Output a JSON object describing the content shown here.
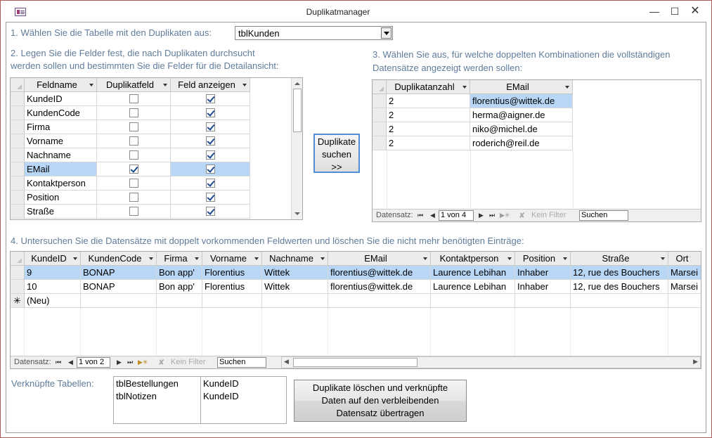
{
  "window": {
    "title": "Duplikatmanager",
    "minimize_icon": "minimize-icon",
    "maximize_icon": "maximize-icon",
    "close_icon": "close-icon"
  },
  "step1": {
    "label": "1. Wählen Sie die Tabelle mit den Duplikaten aus:",
    "combo_value": "tblKunden"
  },
  "step2": {
    "label_line1": "2. Legen Sie die Felder fest, die nach Duplikaten durchsucht",
    "label_line2": "werden sollen und bestimmten Sie die Felder für die Detailansicht:",
    "columns": [
      "Feldname",
      "Duplikatfeld",
      "Feld anzeigen"
    ],
    "rows": [
      {
        "name": "KundeID",
        "dup": false,
        "show": true
      },
      {
        "name": "KundenCode",
        "dup": false,
        "show": true
      },
      {
        "name": "Firma",
        "dup": false,
        "show": true
      },
      {
        "name": "Vorname",
        "dup": false,
        "show": true
      },
      {
        "name": "Nachname",
        "dup": false,
        "show": true
      },
      {
        "name": "EMail",
        "dup": true,
        "show": true,
        "selected": true
      },
      {
        "name": "Kontaktperson",
        "dup": false,
        "show": true
      },
      {
        "name": "Position",
        "dup": false,
        "show": true
      },
      {
        "name": "Straße",
        "dup": false,
        "show": true
      }
    ]
  },
  "search_button": {
    "line1": "Duplikate",
    "line2": "suchen",
    "line3": ">>"
  },
  "step3": {
    "label_line1": "3. Wählen Sie aus, für welche doppelten Kombinationen die vollständigen",
    "label_line2": "Datensätze angezeigt werden sollen:",
    "columns": [
      "Duplikatanzahl",
      "EMail"
    ],
    "rows": [
      [
        "2",
        "florentius@wittek.de"
      ],
      [
        "2",
        "herma@aigner.de"
      ],
      [
        "2",
        "niko@michel.de"
      ],
      [
        "2",
        "roderich@reil.de"
      ]
    ],
    "nav": {
      "label": "Datensatz:",
      "position": "1 von 4",
      "filter": "Kein Filter",
      "search": "Suchen"
    }
  },
  "step4": {
    "label": "4. Untersuchen Sie die Datensätze mit doppelt vorkommenden Feldwerten und löschen Sie die nicht mehr benötigten Einträge:",
    "columns": [
      "KundeID",
      "KundenCode",
      "Firma",
      "Vorname",
      "Nachname",
      "EMail",
      "Kontaktperson",
      "Position",
      "Straße",
      "Ort"
    ],
    "rows": [
      [
        "9",
        "BONAP",
        "Bon app'",
        "Florentius",
        "Wittek",
        "florentius@wittek.de",
        "Laurence Lebihan",
        "Inhaber",
        "12, rue des Bouchers",
        "Marsei"
      ],
      [
        "10",
        "BONAP",
        "Bon app'",
        "Florentius",
        "Wittek",
        "florentius@wittek.de",
        "Laurence Lebihan",
        "Inhaber",
        "12, rue des Bouchers",
        "Marsei"
      ]
    ],
    "new_row_marker": "✳",
    "new_row_label": "(Neu)",
    "nav": {
      "label": "Datensatz:",
      "position": "1 von 2",
      "filter": "Kein Filter",
      "search": "Suchen"
    }
  },
  "linked": {
    "label": "Verknüpfte Tabellen:",
    "rows": [
      [
        "tblBestellungen",
        "KundeID"
      ],
      [
        "tblNotizen",
        "KundeID"
      ]
    ]
  },
  "merge_button": {
    "line1": "Duplikate löschen und verknüpfte",
    "line2": "Daten auf den verbleibenden",
    "line3": "Datensatz übertragen"
  },
  "colors": {
    "label": "#5f7c9a",
    "selection": "#b8d7f6",
    "header": "#ececec"
  }
}
